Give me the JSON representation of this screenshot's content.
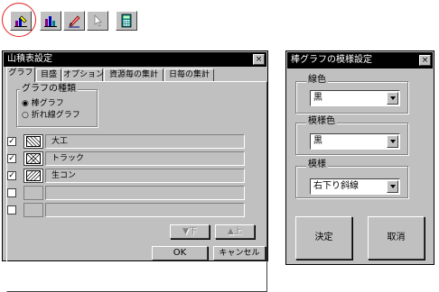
{
  "toolbar": {
    "buttons": [
      {
        "name": "chart-settings-icon"
      },
      {
        "name": "bar-chart-icon"
      },
      {
        "name": "pencil-icon"
      },
      {
        "name": "pointer-icon"
      },
      {
        "name": "calculator-icon"
      }
    ],
    "highlight_color": "#e02020"
  },
  "main_window": {
    "title": "山積表設定",
    "close_label": "×",
    "tabs": [
      "グラフ",
      "目盛",
      "オプション",
      "資源毎の集計",
      "日毎の集計"
    ],
    "active_tab": 0,
    "chart_type_group": {
      "label": "グラフの種類",
      "options": [
        {
          "label": "棒グラフ",
          "selected": true
        },
        {
          "label": "折れ線グラフ",
          "selected": false
        }
      ]
    },
    "rows": [
      {
        "checked": true,
        "pattern": "diag-down",
        "name": "大工"
      },
      {
        "checked": true,
        "pattern": "cross",
        "name": "トラック"
      },
      {
        "checked": true,
        "pattern": "diag-up",
        "name": "生コン"
      },
      {
        "checked": false,
        "pattern": "none",
        "name": ""
      },
      {
        "checked": false,
        "pattern": "none",
        "name": ""
      }
    ],
    "down_label": "▼下",
    "up_label": "▲上",
    "ok_label": "OK",
    "cancel_label": "キャンセル"
  },
  "pattern_dialog": {
    "title": "棒グラフの模様設定",
    "close_label": "×",
    "line_color": {
      "label": "線色",
      "value": "黒"
    },
    "fill_color": {
      "label": "模様色",
      "value": "黒"
    },
    "pattern": {
      "label": "模様",
      "value": "右下り斜線"
    },
    "ok_label": "決定",
    "cancel_label": "取消"
  }
}
